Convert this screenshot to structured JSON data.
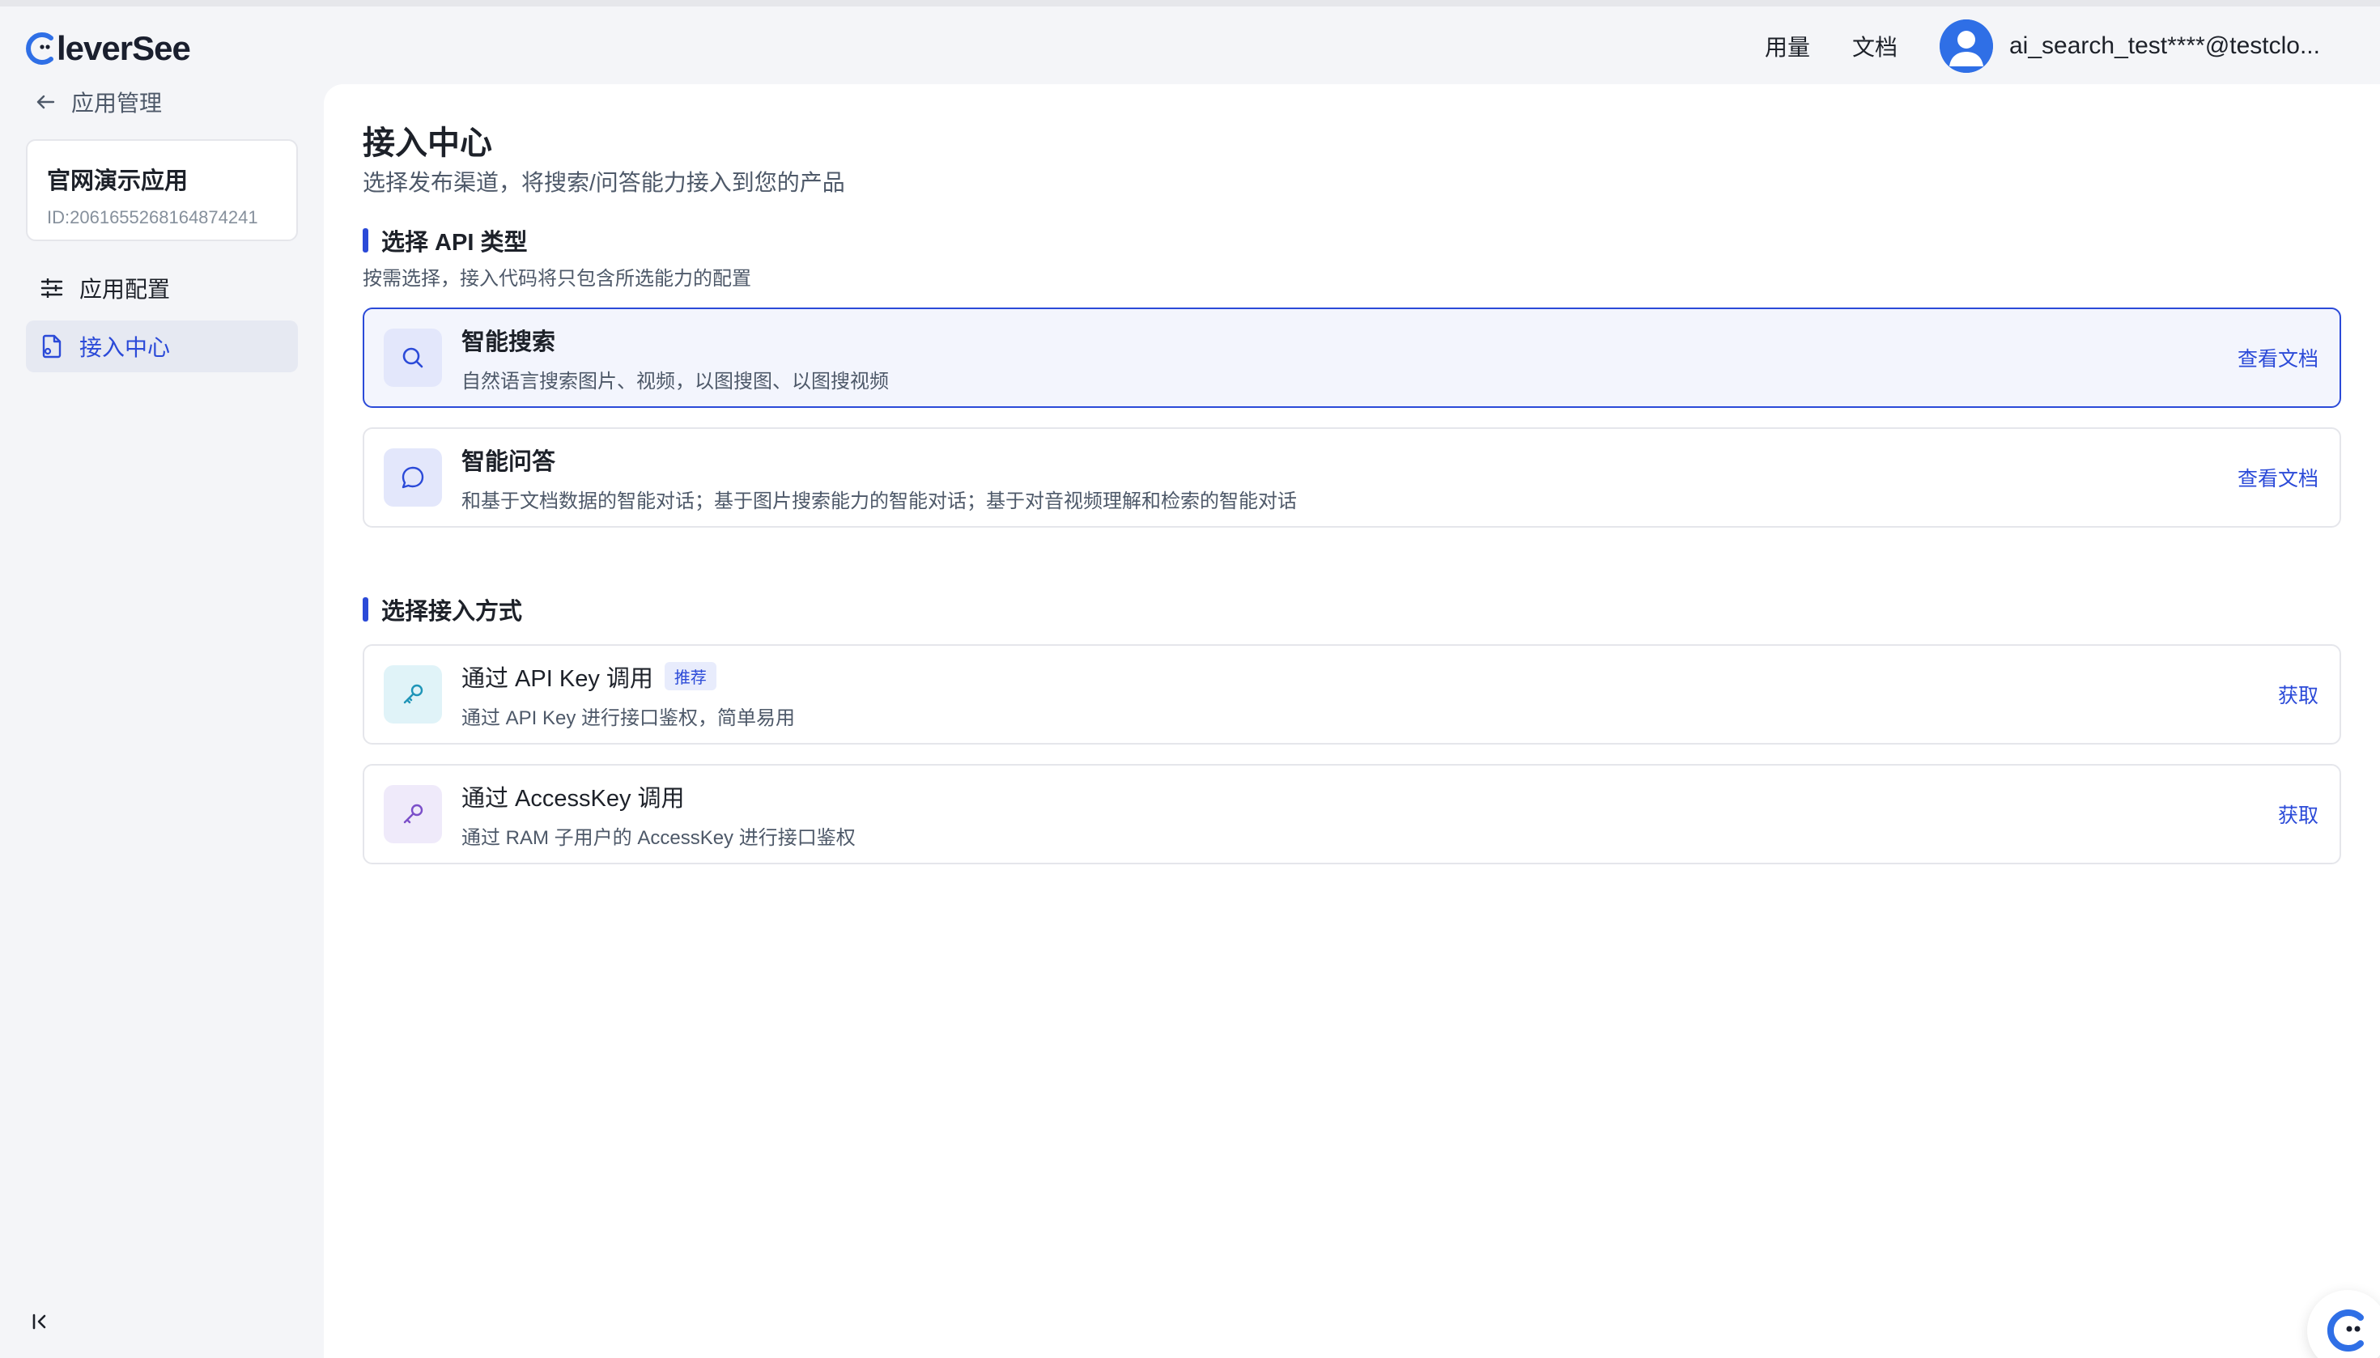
{
  "brand": {
    "logo_text": "leverSee",
    "logo_color": "#2f6fe6"
  },
  "header": {
    "links": [
      {
        "label": "用量"
      },
      {
        "label": "文档"
      }
    ],
    "user": {
      "name": "ai_search_test****@testclo..."
    }
  },
  "sidebar": {
    "back_label": "应用管理",
    "app": {
      "name": "官网演示应用",
      "id_prefix": "ID: ",
      "id": "2061655268164874241"
    },
    "items": [
      {
        "label": "应用配置",
        "icon": "sliders-icon",
        "active": false
      },
      {
        "label": "接入中心",
        "icon": "document-icon",
        "active": true
      }
    ],
    "collapse_icon": "collapse-left-icon"
  },
  "main": {
    "title": "接入中心",
    "subtitle": "选择发布渠道，将搜索/问答能力接入到您的产品",
    "api_section": {
      "title": "选择 API 类型",
      "desc": "按需选择，接入代码将只包含所选能力的配置",
      "options": [
        {
          "title": "智能搜索",
          "desc": "自然语言搜索图片、视频，以图搜图、以图搜视频",
          "link": "查看文档",
          "icon": "search-icon",
          "selected": true
        },
        {
          "title": "智能问答",
          "desc": "和基于文档数据的智能对话；基于图片搜索能力的智能对话；基于对音视频理解和检索的智能对话",
          "link": "查看文档",
          "icon": "chat-bubble-icon",
          "selected": false
        }
      ]
    },
    "access_section": {
      "title": "选择接入方式",
      "options": [
        {
          "title": "通过 API Key 调用",
          "badge": "推荐",
          "desc": "通过 API Key 进行接口鉴权，简单易用",
          "link": "获取",
          "icon": "key-icon"
        },
        {
          "title": "通过 AccessKey 调用",
          "desc": "通过 RAM 子用户的 AccessKey 进行接口鉴权",
          "link": "获取",
          "icon": "key-icon"
        }
      ]
    }
  },
  "colors": {
    "accent": "#2b4ad8",
    "background": "#f4f5f8",
    "selected_bg": "#f3f5fd"
  }
}
